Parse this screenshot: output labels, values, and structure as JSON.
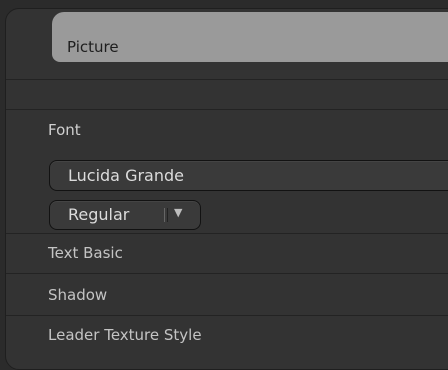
{
  "picture": {
    "label": "Picture"
  },
  "font_section": {
    "label": "Font",
    "font_family": "Lucida Grande",
    "font_style": "Regular"
  },
  "sections": {
    "text_basic": "Text Basic",
    "shadow": "Shadow",
    "leader_texture_style": "Leader Texture Style"
  },
  "icons": {
    "style_dropdown": "chevron-down-icon"
  }
}
